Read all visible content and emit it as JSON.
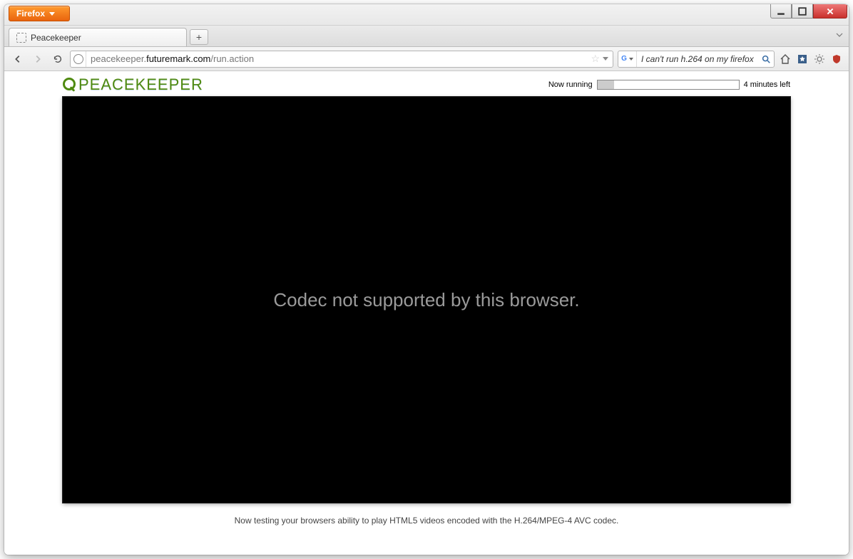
{
  "app": {
    "firefox_button_label": "Firefox"
  },
  "tabs": {
    "active_title": "Peacekeeper"
  },
  "nav": {
    "url_prefix": "peacekeeper.",
    "url_domain": "futuremark.com",
    "url_path": "/run.action",
    "search_value": "I can't run h.264 on my firefox?"
  },
  "page": {
    "logo_text": "PEACEKEEPER",
    "status_label": "Now running",
    "status_time": "4 minutes left",
    "codec_message": "Codec not supported by this browser.",
    "caption": "Now testing your browsers ability to play HTML5 videos encoded with the H.264/MPEG-4 AVC codec."
  }
}
